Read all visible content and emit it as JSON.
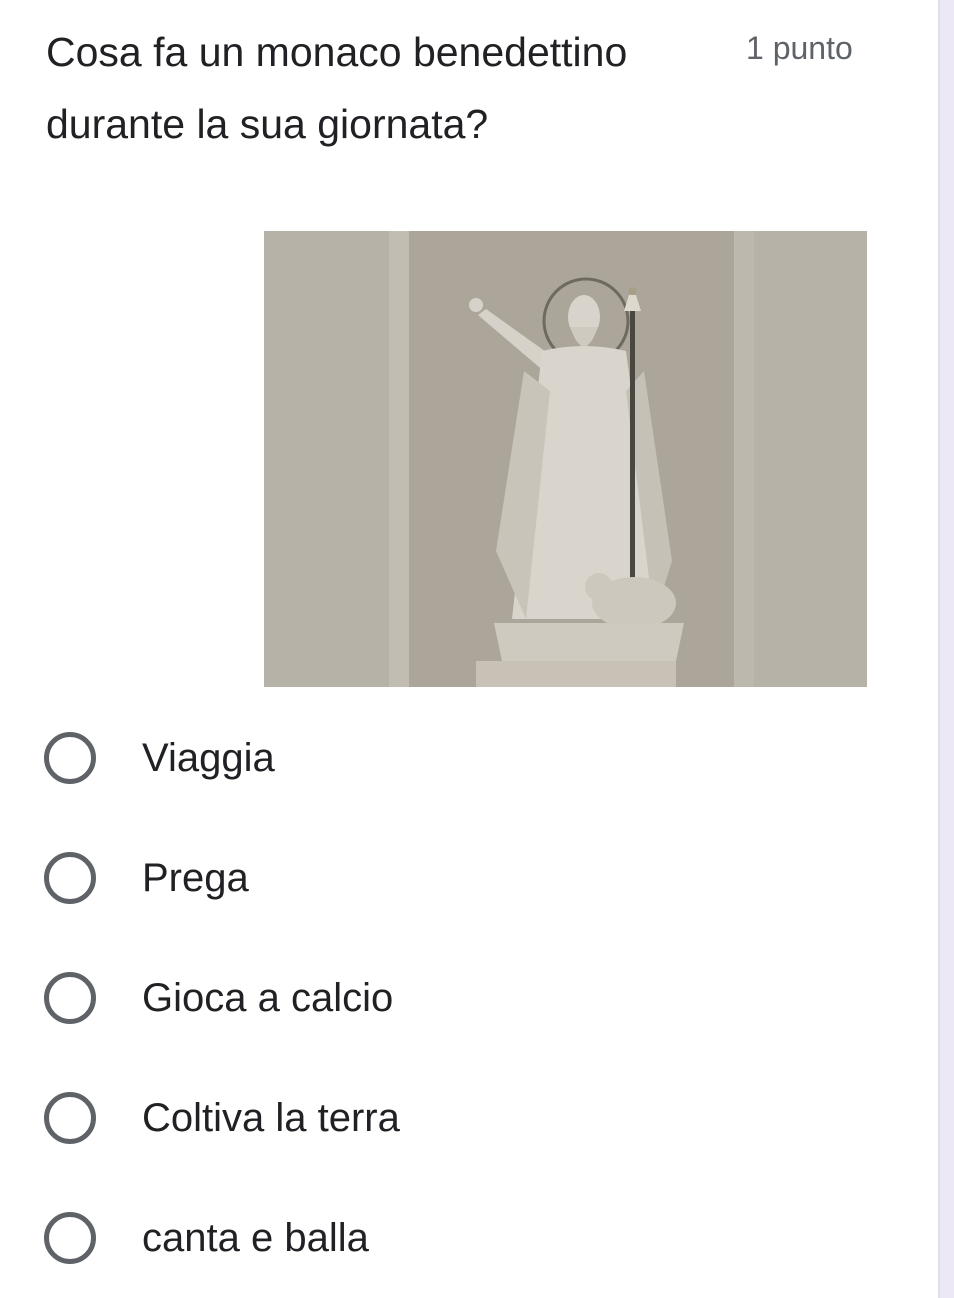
{
  "question": {
    "title": "Cosa fa un monaco benedettino durante la sua giornata?",
    "points": "1 punto"
  },
  "options": [
    {
      "label": "Viaggia"
    },
    {
      "label": "Prega"
    },
    {
      "label": "Gioca a calcio"
    },
    {
      "label": "Coltiva la terra"
    },
    {
      "label": "canta e balla"
    }
  ],
  "colors": {
    "text": "#202124",
    "secondary": "#5f6368",
    "radio_border": "#5f6368",
    "side_border": "#ece8f6"
  }
}
